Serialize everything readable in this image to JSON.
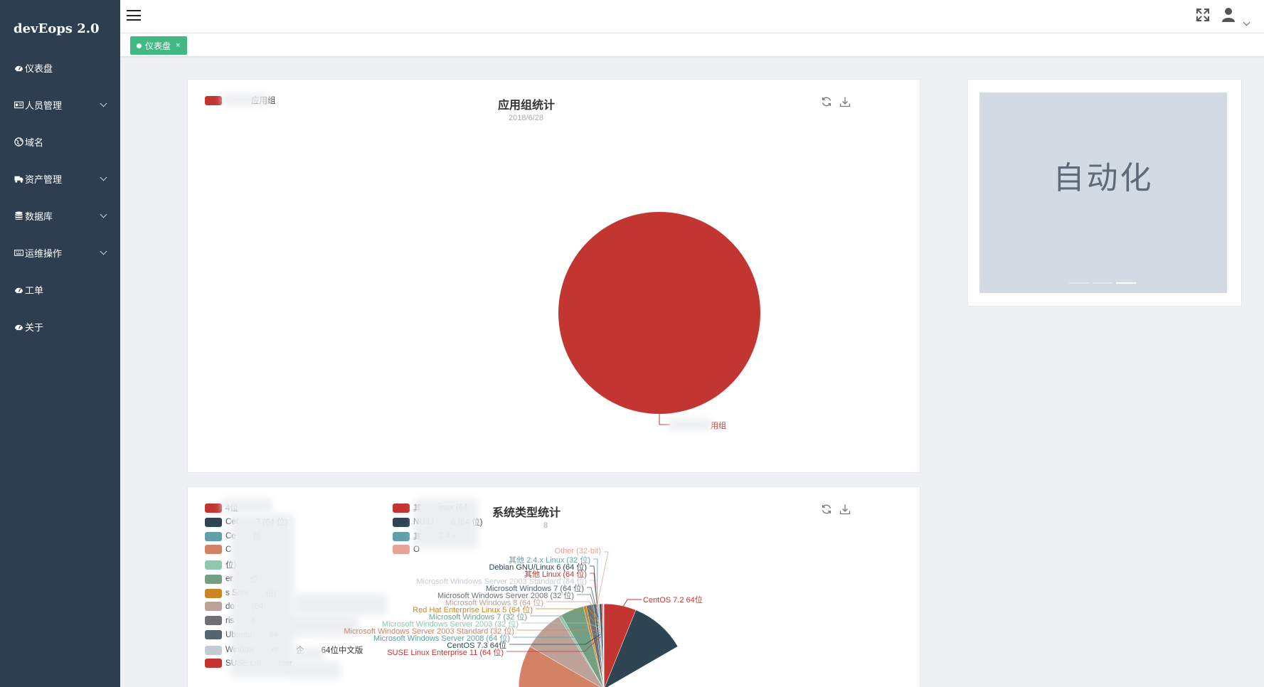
{
  "app": {
    "brand": "devEops 2.0"
  },
  "sidebar": {
    "items": [
      {
        "label": "仪表盘",
        "icon": "dashboard-icon",
        "expandable": false
      },
      {
        "label": "人员管理",
        "icon": "id-card-icon",
        "expandable": true
      },
      {
        "label": "域名",
        "icon": "globe-icon",
        "expandable": false
      },
      {
        "label": "资产管理",
        "icon": "truck-icon",
        "expandable": true
      },
      {
        "label": "数据库",
        "icon": "database-icon",
        "expandable": true
      },
      {
        "label": "运维操作",
        "icon": "keyboard-icon",
        "expandable": true
      },
      {
        "label": "工单",
        "icon": "dashboard-icon",
        "expandable": false
      },
      {
        "label": "关于",
        "icon": "dashboard-icon",
        "expandable": false
      }
    ]
  },
  "tabs": [
    {
      "label": "仪表盘",
      "close": "×",
      "active": true
    }
  ],
  "chart1": {
    "title": "应用组统计",
    "subtitle": "2018/6/28",
    "legend": "应用组",
    "slice_label": "用组",
    "color": "#c23531"
  },
  "chart2": {
    "title": "系统类型统计",
    "subtitle": "8",
    "legend_left": [
      {
        "label": "4位",
        "color": "#c23531"
      },
      {
        "label": "Cer",
        "label2": "7 (64 位)",
        "color": "#2f4554"
      },
      {
        "label": "Ce",
        "label2": "位",
        "color": "#61a0a8"
      },
      {
        "label": "C",
        "color": "#d48265"
      },
      {
        "label": "位)",
        "color": "#91c7ae"
      },
      {
        "label": "er",
        "label2": "位",
        "color": "#749f83"
      },
      {
        "label": "s Serv",
        "label2": "位)",
        "color": "#ca8622"
      },
      {
        "label": "do",
        "label2": "(64",
        "color": "#bda29a"
      },
      {
        "label": "ris",
        "label2": "6",
        "color": "#6e7074"
      },
      {
        "label": "Ubuntu",
        "label2": "64",
        "color": "#546570"
      },
      {
        "label": "Window",
        "label2": "er",
        "label3": "企",
        "label4": "64位中文版",
        "color": "#c4ccd3"
      },
      {
        "label": "SUSE Lin",
        "label2": "nter",
        "color": "#c23531"
      }
    ],
    "legend_right": [
      {
        "label": "其",
        "label2": "inux (64",
        "color": "#c23531"
      },
      {
        "label": "NU/Li",
        "label2": "6 (64 位)",
        "color": "#2f4554"
      },
      {
        "label": "其",
        "label2": "2.4.x",
        "color": "#61a0a8"
      },
      {
        "label": "O",
        "color": "#e8a395"
      }
    ],
    "slice_labels": [
      {
        "text": "Other (32-bit)",
        "color": "#e8a395"
      },
      {
        "text": "其他 2.4.x Linux (32 位)",
        "color": "#61a0a8"
      },
      {
        "text": "Debian GNU/Linux 6 (64 位)",
        "color": "#2f4554"
      },
      {
        "text": "其他 Linux (64 位)",
        "color": "#c23531"
      },
      {
        "text": "Microsoft Windows Server 2003 Standard (64 位)",
        "color": "#c4ccd3"
      },
      {
        "text": "Microsoft Windows 7 (64 位)",
        "color": "#546570"
      },
      {
        "text": "Microsoft Windows Server 2008 (32 位)",
        "color": "#6e7074"
      },
      {
        "text": "Microsoft Windows 8 (64 位)",
        "color": "#bda29a"
      },
      {
        "text": "Red Hat Enterprise Linux 5 (64 位)",
        "color": "#ca8622"
      },
      {
        "text": "Microsoft Windows 7 (32 位)",
        "color": "#749f83"
      },
      {
        "text": "Microsoft Windows Server 2003 (32 位)",
        "color": "#91c7ae"
      },
      {
        "text": "Microsoft Windows Server 2003 Standard (32 位)",
        "color": "#d48265"
      },
      {
        "text": "Microsoft Windows Server 2008 (64 位)",
        "color": "#61a0a8"
      },
      {
        "text": "CentOS  7.3 64位",
        "color": "#2f4554"
      },
      {
        "text": "SUSE Linux Enterprise 11 (64 位)",
        "color": "#c23531"
      },
      {
        "text": "CentOS  7.2 64位",
        "color": "#c23531"
      }
    ]
  },
  "carousel": {
    "text": "自动化",
    "slides": 3,
    "active_index": 2
  }
}
